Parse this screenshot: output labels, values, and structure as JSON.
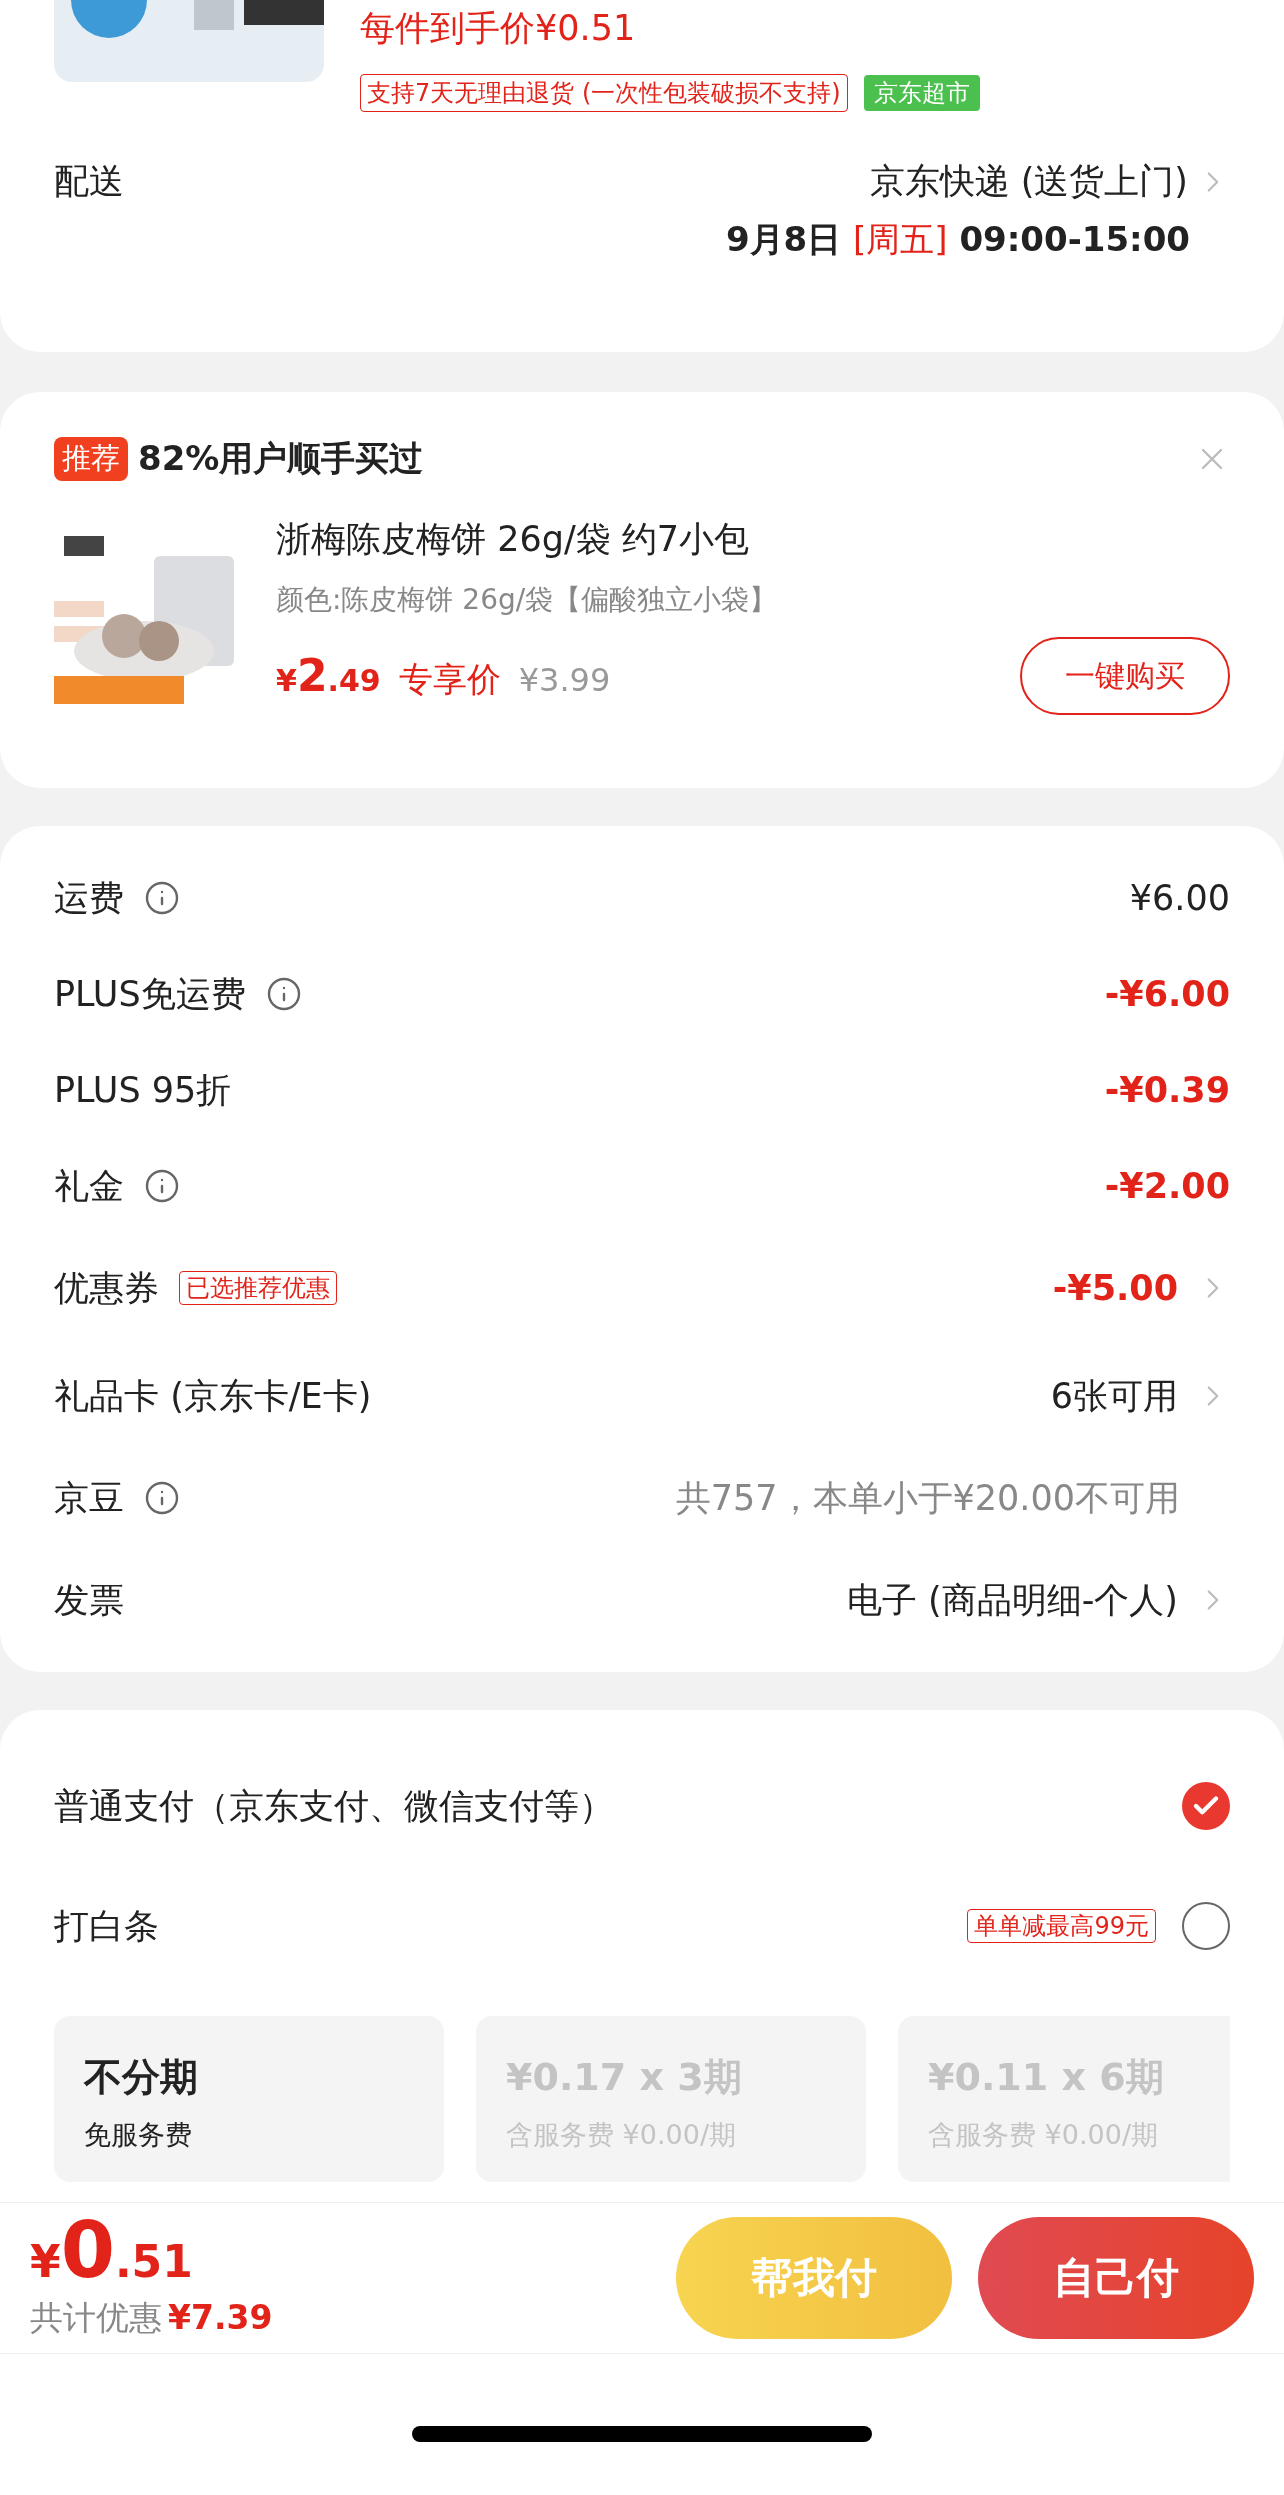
{
  "product": {
    "price_text": "每件到手价¥0.51",
    "tags": [
      {
        "text": "支持7天无理由退货 (一次性包装破损不支持)",
        "kind": "outline"
      },
      {
        "text": "京东超市",
        "kind": "filled"
      }
    ]
  },
  "delivery": {
    "label": "配送",
    "method": "京东快递 (送货上门)",
    "date": "9月8日",
    "weekday": "[周五]",
    "time": "09:00-15:00"
  },
  "recommend": {
    "badge": "推荐",
    "headline": "82%用户顺手买过",
    "product": {
      "title": "浙梅陈皮梅饼 26g/袋 约7小包",
      "spec": "颜色:陈皮梅饼 26g/袋【偏酸独立小袋】",
      "price_symbol": "¥",
      "price_int": "2",
      "price_dec": ".49",
      "price_label": "专享价",
      "original_price": "¥3.99"
    },
    "buy_button": "一键购买"
  },
  "fees": [
    {
      "label": "运费",
      "info": true,
      "value": "¥6.00",
      "kind": "normal",
      "chevron": false
    },
    {
      "label": "PLUS免运费",
      "info": true,
      "value": "-¥6.00",
      "kind": "discount",
      "chevron": false
    },
    {
      "label": "PLUS 95折",
      "info": false,
      "value": "-¥0.39",
      "kind": "discount",
      "chevron": false
    },
    {
      "label": "礼金",
      "info": true,
      "value": "-¥2.00",
      "kind": "discount",
      "chevron": false
    },
    {
      "label": "优惠券",
      "info": false,
      "tag": "已选推荐优惠",
      "value": "-¥5.00",
      "kind": "discount",
      "chevron": true
    },
    {
      "label": "礼品卡 (京东卡/E卡)",
      "info": false,
      "value": "6张可用",
      "kind": "normal",
      "chevron": true
    },
    {
      "label": "京豆",
      "info": true,
      "value": "共757，本单小于¥20.00不可用",
      "kind": "muted",
      "chevron": false
    },
    {
      "label": "发票",
      "info": false,
      "value": "电子 (商品明细-个人)",
      "kind": "normal",
      "chevron": true
    }
  ],
  "payment": {
    "methods": [
      {
        "label": "普通支付（京东支付、微信支付等）",
        "selected": true
      },
      {
        "label": "打白条",
        "tag": "单单减最高99元",
        "selected": false
      }
    ],
    "installments": [
      {
        "title": "不分期",
        "subtitle": "免服务费",
        "disabled": false
      },
      {
        "title": "¥0.17 x 3期",
        "subtitle": "含服务费 ¥0.00/期",
        "disabled": true
      },
      {
        "title": "¥0.11 x 6期",
        "subtitle": "含服务费 ¥0.00/期",
        "disabled": true
      }
    ]
  },
  "footer": {
    "price_symbol": "¥",
    "price_int": "0",
    "price_dec": ".51",
    "savings_label": "共计优惠",
    "savings": "¥7.39",
    "buttons": [
      {
        "label": "帮我付",
        "kind": "helper"
      },
      {
        "label": "自己付",
        "kind": "primary"
      }
    ]
  }
}
